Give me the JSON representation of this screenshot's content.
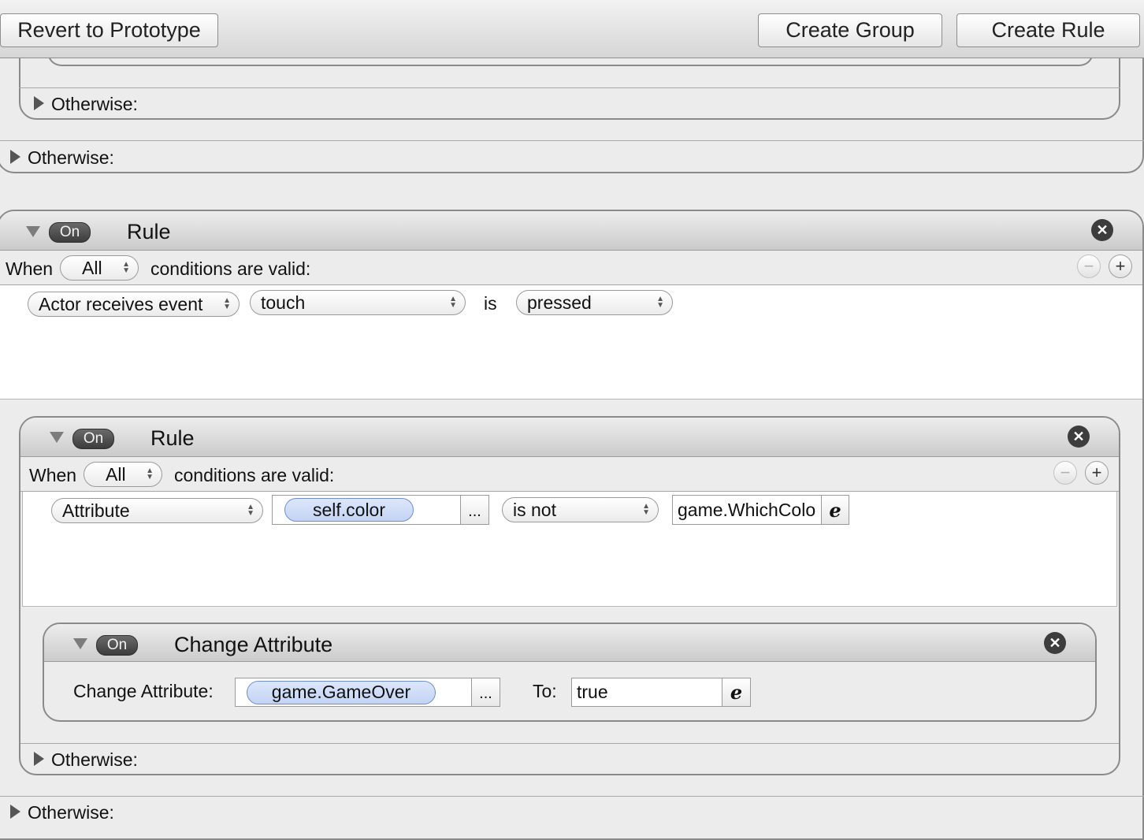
{
  "toolbar": {
    "revert_label": "Revert to Prototype",
    "create_group_label": "Create Group",
    "create_rule_label": "Create Rule"
  },
  "top_fragment": {
    "inner_otherwise_label": "Otherwise:",
    "outer_otherwise_label": "Otherwise:"
  },
  "outer_rule": {
    "toggle_label": "On",
    "title": "Rule",
    "when_label": "When",
    "match_selected": "All",
    "conditions_suffix": "conditions are valid:",
    "condition": {
      "type": "Actor receives event",
      "event": "touch",
      "operator": "is",
      "state": "pressed"
    },
    "otherwise_label": "Otherwise:"
  },
  "inner_rule": {
    "toggle_label": "On",
    "title": "Rule",
    "when_label": "When",
    "match_selected": "All",
    "conditions_suffix": "conditions are valid:",
    "condition": {
      "type": "Attribute",
      "attribute": "self.color",
      "browse_label": "...",
      "comparison": "is not",
      "value": "game.WhichColo"
    },
    "otherwise_label": "Otherwise:"
  },
  "change_attribute": {
    "toggle_label": "On",
    "title": "Change Attribute",
    "field_label": "Change Attribute:",
    "attribute": "game.GameOver",
    "browse_label": "...",
    "to_label": "To:",
    "value": "true"
  },
  "icons": {
    "close": "close-x-icon",
    "expression": "expression-e-icon",
    "minus": "minus-icon",
    "plus": "plus-icon"
  },
  "colors": {
    "token_blue": "#c9d8f6",
    "toggle_dark": "#4a4a4a"
  }
}
